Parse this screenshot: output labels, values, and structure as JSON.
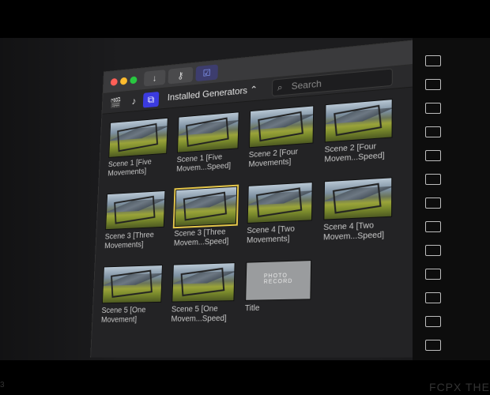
{
  "window": {
    "generators_label": "Installed Generators ⌃",
    "search_placeholder": "Search",
    "titlebar": {
      "down_glyph": "↓",
      "key_glyph": "⚷",
      "check_glyph": "☑"
    },
    "toolbar": {
      "icon1": "🎬",
      "icon2": "♪",
      "icon3": "⧉"
    }
  },
  "tiles": [
    {
      "label": "Scene 1 [Five Movements]",
      "selected": false
    },
    {
      "label": "Scene 1 [Five Movem...Speed]",
      "selected": false
    },
    {
      "label": "Scene 2 [Four Movements]",
      "selected": false
    },
    {
      "label": "Scene 2 [Four Movem...Speed]",
      "selected": false
    },
    {
      "label": "Scene 3 [Three Movements]",
      "selected": false
    },
    {
      "label": "Scene 3 [Three Movem...Speed]",
      "selected": true
    },
    {
      "label": "Scene 4 [Two Movements]",
      "selected": false
    },
    {
      "label": "Scene 4 [Two Movem...Speed]",
      "selected": false
    },
    {
      "label": "Scene 5 [One Movement]",
      "selected": false
    },
    {
      "label": "Scene 5 [One Movem...Speed]",
      "selected": false
    },
    {
      "label": "Title",
      "selected": false,
      "blank_text": "PHOTO RECORD"
    }
  ],
  "watermark": "FCPX THE",
  "watermark_left": "3"
}
